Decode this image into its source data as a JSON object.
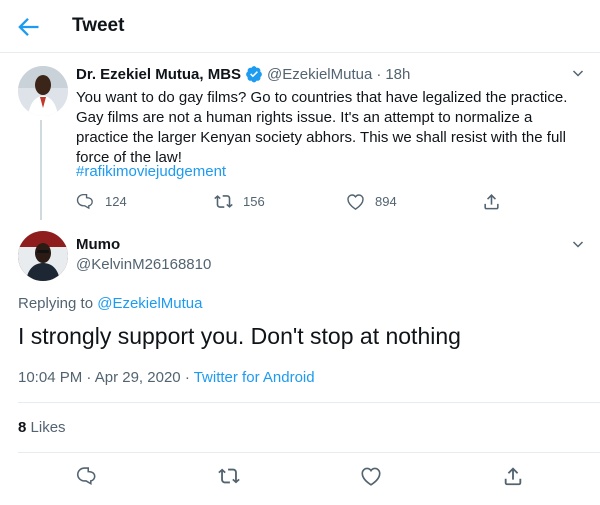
{
  "header": {
    "back_icon": "arrow-left-icon",
    "title": "Tweet"
  },
  "parent_tweet": {
    "author_name": "Dr. Ezekiel Mutua, MBS",
    "verified": true,
    "handle": "@EzekielMutua",
    "separator": "·",
    "time_ago": "18h",
    "text": "You want to do gay films? Go to countries that have legalized the practice. Gay films are not a human rights issue. It's an attempt to normalize a practice the larger Kenyan society abhors. This we shall resist with the full force of the law!",
    "hashtag": "#rafikimoviejudgement",
    "replies": "124",
    "retweets": "156",
    "likes": "894"
  },
  "reply_tweet": {
    "author_name": "Mumo",
    "handle": "@KelvinM26168810",
    "replying_to_label": "Replying to",
    "replying_to_handle": "@EzekielMutua",
    "text": "I strongly support you. Don't stop at nothing",
    "time": "10:04 PM",
    "date": "Apr 29, 2020",
    "separator": "·",
    "source": "Twitter for Android",
    "likes_count": "8",
    "likes_label": "Likes"
  },
  "colors": {
    "accent": "#1d9bf0",
    "text": "#0f1419",
    "secondary": "#536471",
    "divider": "#e6ecf0"
  }
}
